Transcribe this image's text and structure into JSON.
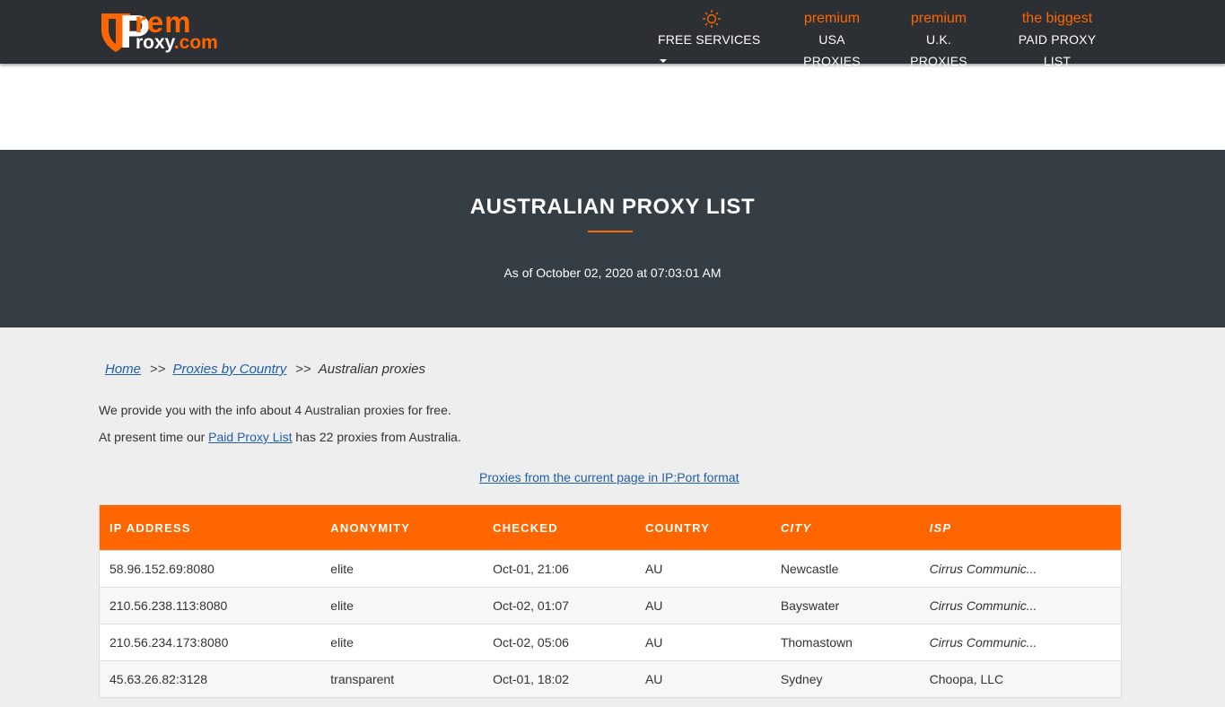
{
  "logo": {
    "letter": "P",
    "top": "rem",
    "bottom_first": "roxy",
    "bottom_dot": ".",
    "bottom_last": "com"
  },
  "nav": {
    "free_services": {
      "top_icon": "sun-icon",
      "label": "FREE SERVICES"
    },
    "usa": {
      "top": "premium",
      "label": "USA PROXIES"
    },
    "uk": {
      "top": "premium",
      "label": "U.K. PROXIES"
    },
    "paid": {
      "top": "the biggest",
      "label": "PAID PROXY LIST"
    }
  },
  "hero": {
    "title": "AUSTRALIAN PROXY LIST",
    "subtitle": "As of October 02, 2020 at 07:03:01 AM"
  },
  "breadcrumb": {
    "home": "Home",
    "sep1": ">>",
    "by_country": "Proxies by Country",
    "sep2": ">>",
    "current": "Australian proxies"
  },
  "info": {
    "line1": "We provide you with the info about 4 Australian proxies for free.",
    "line2_prefix": "At present time our ",
    "line2_link": "Paid Proxy List",
    "line2_suffix": " has 22 proxies from Australia."
  },
  "format_link": "Proxies from the current page in IP:Port format",
  "table": {
    "headers": [
      "IP ADDRESS",
      "ANONYMITY",
      "CHECKED",
      "COUNTRY",
      "CITY",
      "ISP"
    ],
    "rows": [
      {
        "ip": "58.96.152.69:8080",
        "anonymity": "elite",
        "checked": "Oct-01, 21:06",
        "country": "AU",
        "city": "Newcastle",
        "isp": "Cirrus Communic..."
      },
      {
        "ip": "210.56.238.113:8080",
        "anonymity": "elite",
        "checked": "Oct-02, 01:07",
        "country": "AU",
        "city": "Bayswater",
        "isp": "Cirrus Communic..."
      },
      {
        "ip": "210.56.234.173:8080",
        "anonymity": "elite",
        "checked": "Oct-02, 05:06",
        "country": "AU",
        "city": "Thomastown",
        "isp": "Cirrus Communic..."
      },
      {
        "ip": "45.63.26.82:3128",
        "anonymity": "transparent",
        "checked": "Oct-01, 18:02",
        "country": "AU",
        "city": "Sydney",
        "isp": "Choopa, LLC"
      }
    ]
  },
  "colors": {
    "accent": "#ff6600",
    "topbar": "#2c2f33",
    "hero": "#343e44",
    "link": "#1f5fa8"
  }
}
